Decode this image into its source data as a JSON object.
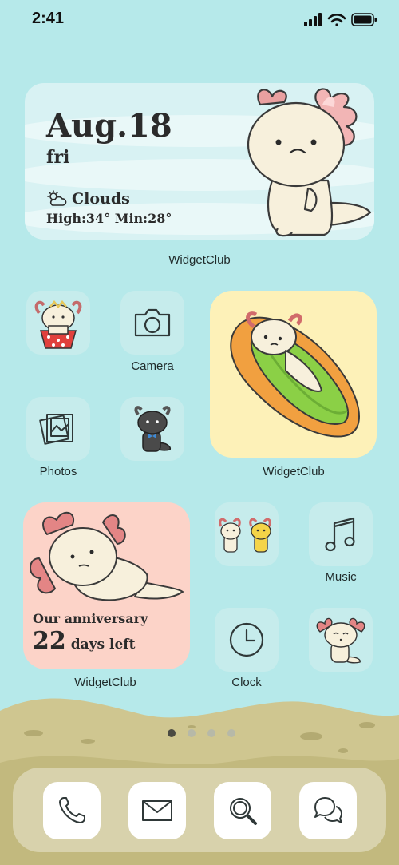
{
  "status_bar": {
    "time": "2:41",
    "icons": [
      "signal-icon",
      "wifi-icon",
      "battery-icon"
    ]
  },
  "weather_widget": {
    "date": "Aug.18",
    "day": "fri",
    "condition": "Clouds",
    "condition_icon": "partly-cloudy-icon",
    "temps": "High:34° Min:28°",
    "caption": "WidgetClub"
  },
  "apps": {
    "axolotl_cupcake": {
      "icon": "axolotl-cupcake-icon"
    },
    "camera": {
      "label": "Camera",
      "icon": "camera-icon"
    },
    "photos": {
      "label": "Photos",
      "icon": "photos-icon"
    },
    "black_axolotl": {
      "icon": "black-axolotl-icon"
    },
    "two_axolotls": {
      "icon": "two-axolotls-icon"
    },
    "music": {
      "label": "Music",
      "icon": "music-note-icon"
    },
    "clock": {
      "label": "Clock",
      "icon": "clock-icon"
    },
    "axolotl_sitting": {
      "icon": "axolotl-sitting-icon"
    }
  },
  "hotdog_widget": {
    "caption": "WidgetClub"
  },
  "anniversary_widget": {
    "line1": "Our anniversary",
    "number": "22",
    "unit": "days left",
    "caption": "WidgetClub"
  },
  "page_indicator": {
    "pages": 4,
    "current": 1
  },
  "dock": {
    "items": [
      {
        "name": "phone",
        "icon": "phone-icon"
      },
      {
        "name": "mail",
        "icon": "mail-icon"
      },
      {
        "name": "search",
        "icon": "search-icon"
      },
      {
        "name": "messages",
        "icon": "chat-bubbles-icon"
      }
    ]
  },
  "colors": {
    "background": "#b6e9ea",
    "sand": "#cfc690",
    "weather_card": "#d8f2f3",
    "hotdog_card": "#fdf1b8",
    "anniversary_card": "#fcd3c8",
    "tile": "#c6ecec",
    "icon_stroke": "#2f3838"
  }
}
